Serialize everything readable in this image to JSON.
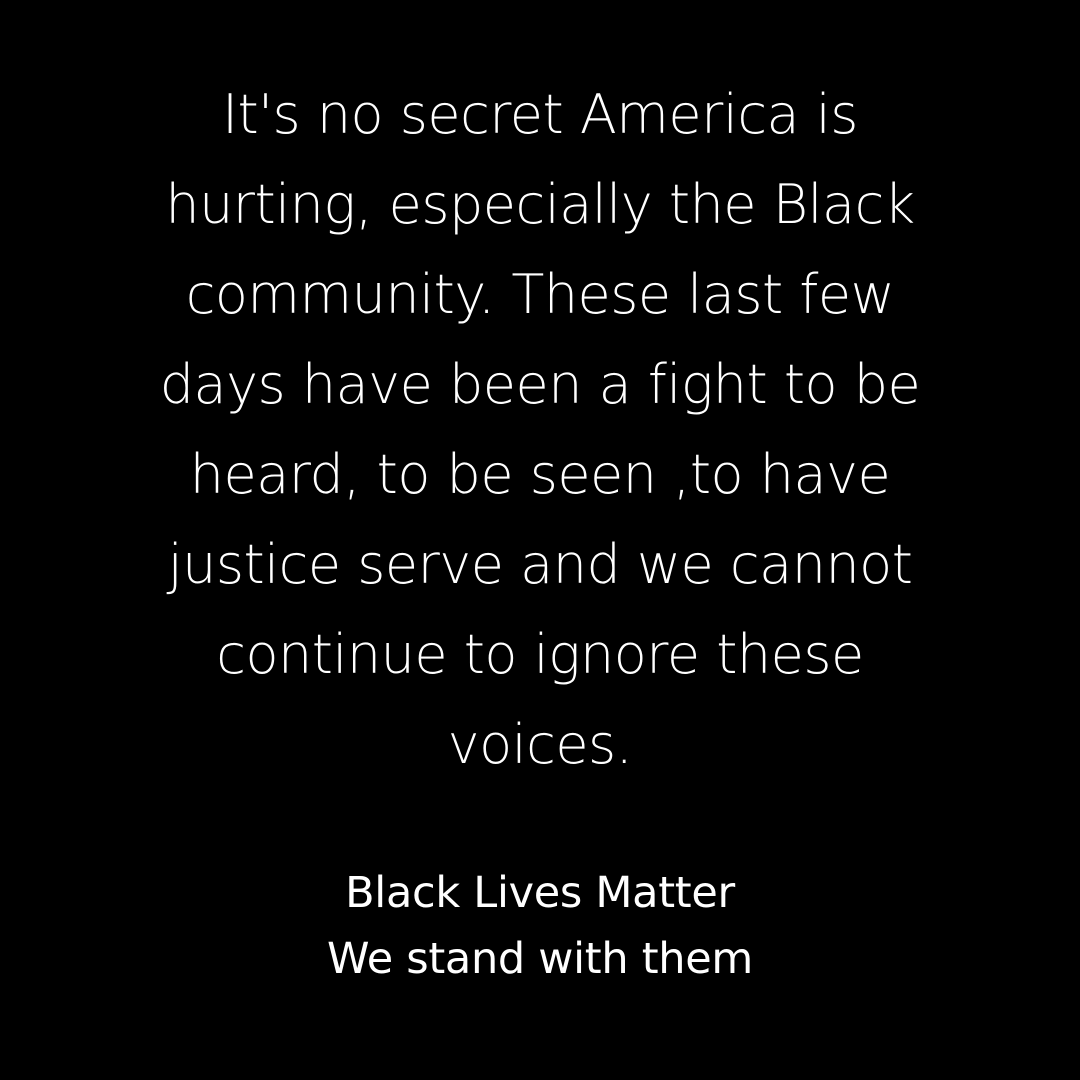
{
  "background_color": "#000000",
  "text_color": "#ffffff",
  "statement": {
    "lines": [
      "It's no secret America is",
      "hurting, especially the Black",
      "community. These last few",
      "days have been a fight to be",
      "heard, to be seen ,to have",
      "justice serve and we cannot",
      "continue to ignore these",
      "voices."
    ]
  },
  "closing": {
    "lines": [
      "Black Lives Matter",
      "We stand with them"
    ]
  }
}
